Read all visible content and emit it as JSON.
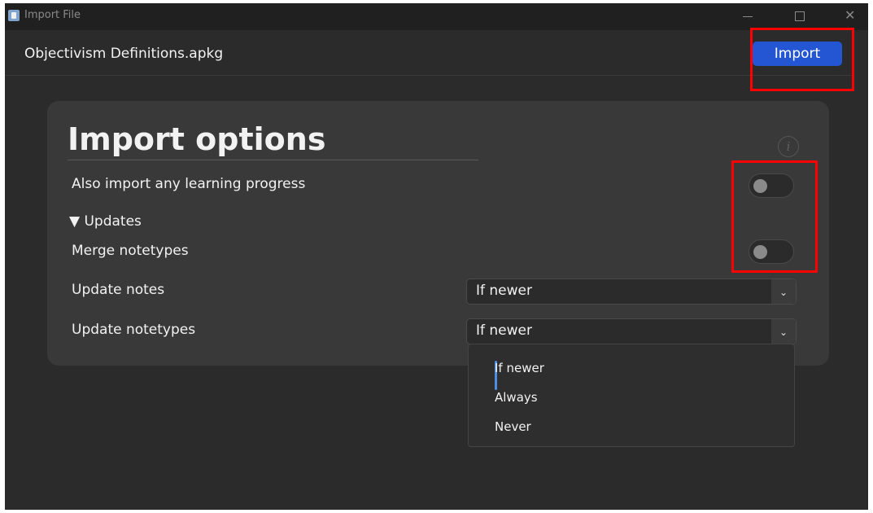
{
  "window": {
    "title": "Import File"
  },
  "header": {
    "filename": "Objectivism Definitions.apkg",
    "import_label": "Import"
  },
  "options": {
    "title": "Import options",
    "info_glyph": "i",
    "progress_label": "Also import any learning progress",
    "progress_enabled": false,
    "updates_label": "▼ Updates",
    "merge_label": "Merge notetypes",
    "merge_enabled": false,
    "update_notes_label": "Update notes",
    "update_notes_value": "If newer",
    "update_notetypes_label": "Update notetypes",
    "update_notetypes_value": "If newer"
  },
  "dropdown": {
    "options": [
      "If newer",
      "Always",
      "Never"
    ],
    "selected": "If newer"
  },
  "colors": {
    "accent": "#2456d3",
    "highlight": "#ff0000",
    "selection_bar": "#4e8fe6"
  }
}
